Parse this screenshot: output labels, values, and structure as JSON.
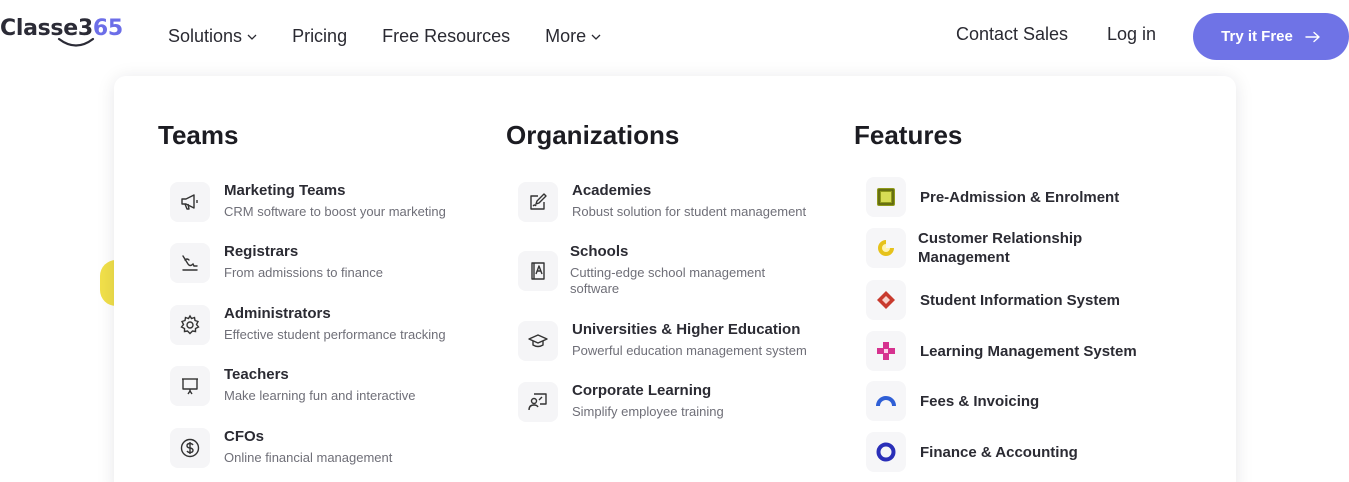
{
  "header": {
    "logo": {
      "text_main": "Classe3",
      "text_accent": "65"
    },
    "nav": [
      {
        "label": "Solutions",
        "has_dropdown": true,
        "icon": "chevron-down-icon"
      },
      {
        "label": "Pricing",
        "has_dropdown": false
      },
      {
        "label": "Free Resources",
        "has_dropdown": false
      },
      {
        "label": "More",
        "has_dropdown": true,
        "icon": "chevron-down-icon"
      }
    ],
    "contact_label": "Contact Sales",
    "login_label": "Log in",
    "cta_label": "Try it Free",
    "cta_icon": "arrow-right-icon",
    "cta_color": "#6f73e6"
  },
  "menu": {
    "teams": {
      "title": "Teams",
      "items": [
        {
          "title": "Marketing Teams",
          "desc": "CRM software to boost your marketing",
          "icon": "megaphone-icon"
        },
        {
          "title": "Registrars",
          "desc": "From admissions to finance",
          "icon": "signature-icon"
        },
        {
          "title": "Administrators",
          "desc": "Effective student performance tracking",
          "icon": "gear-icon"
        },
        {
          "title": "Teachers",
          "desc": "Make learning fun and interactive",
          "icon": "presentation-board-icon"
        },
        {
          "title": "CFOs",
          "desc": "Online financial management",
          "icon": "dollar-circle-icon"
        }
      ]
    },
    "organizations": {
      "title": "Organizations",
      "items": [
        {
          "title": "Academies",
          "desc": "Robust solution for student management",
          "icon": "edit-document-icon"
        },
        {
          "title": "Schools",
          "desc": "Cutting-edge school management software",
          "icon": "book-icon"
        },
        {
          "title": "Universities & Higher Education",
          "desc": "Powerful education management system",
          "icon": "graduation-cap-icon"
        },
        {
          "title": "Corporate Learning",
          "desc": "Simplify employee training",
          "icon": "trainer-icon"
        }
      ]
    },
    "features": {
      "title": "Features",
      "items": [
        {
          "title": "Pre-Admission & Enrolment",
          "icon": "square-frame-icon",
          "color": "#8f9a1a"
        },
        {
          "title": "Customer Relationship Management",
          "icon": "pie-slice-icon",
          "color": "#e6c21b"
        },
        {
          "title": "Student Information System",
          "icon": "diamond-icon",
          "color": "#c83a2e"
        },
        {
          "title": "Learning Management System",
          "icon": "cross-icon",
          "color": "#d6328f"
        },
        {
          "title": "Fees & Invoicing",
          "icon": "arc-icon",
          "color": "#2f5fd6"
        },
        {
          "title": "Finance & Accounting",
          "icon": "ring-icon",
          "color": "#2a2fb8"
        }
      ]
    }
  }
}
